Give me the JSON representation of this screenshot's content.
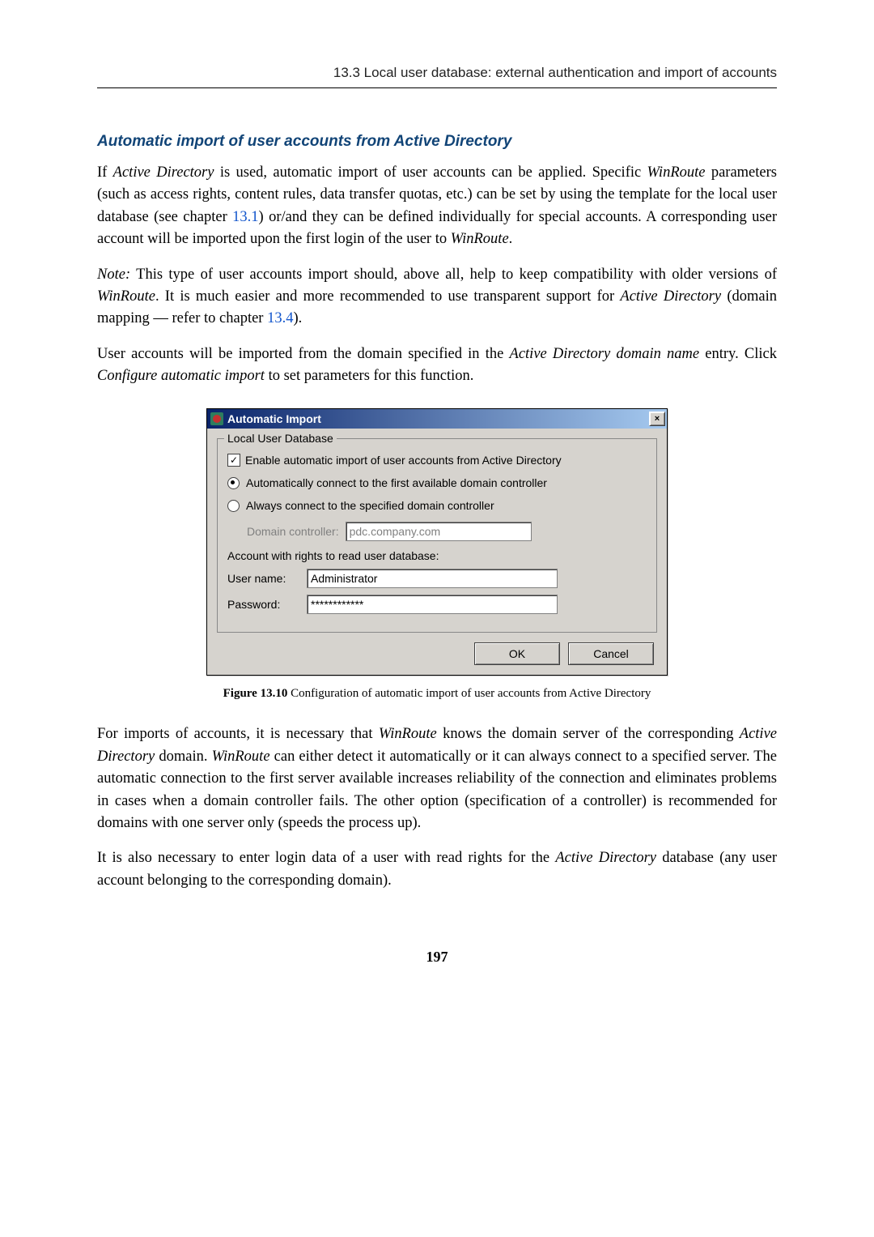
{
  "header": "13.3  Local user database: external authentication and import of accounts",
  "section_heading": "Automatic import of user accounts from Active Directory",
  "para1_a": "If ",
  "para1_b": "Active Directory",
  "para1_c": " is used, automatic import of user accounts can be applied. Specific ",
  "para1_d": "WinRoute",
  "para1_e": " parameters (such as access rights, content rules, data transfer quotas, etc.) can be set by using the template for the local user database (see chapter ",
  "para1_link": "13.1",
  "para1_f": ") or/and they can be defined individually for special accounts. A corresponding user account will be imported upon the first login of the user to ",
  "para1_g": "WinRoute",
  "para1_h": ".",
  "para2_a": "Note:",
  "para2_b": " This type of user accounts import should, above all, help to keep compatibility with older versions of ",
  "para2_c": "WinRoute",
  "para2_d": ". It is much easier and more recommended to use transparent support for ",
  "para2_e": "Active Directory",
  "para2_f": " (domain mapping — refer to chapter ",
  "para2_link": "13.4",
  "para2_g": ").",
  "para3_a": "User accounts will be imported from the domain specified in the ",
  "para3_b": "Active Directory domain name",
  "para3_c": " entry. Click ",
  "para3_d": "Configure automatic import",
  "para3_e": " to set parameters for this function.",
  "dialog": {
    "title": "Automatic Import",
    "close": "×",
    "group_title": "Local User Database",
    "enable_label": "Enable automatic import of user accounts from Active Directory",
    "radio_auto": "Automatically connect to the first available domain controller",
    "radio_spec": "Always connect to the specified domain controller",
    "dc_label": "Domain controller:",
    "dc_value": "pdc.company.com",
    "account_section": "Account with rights to read user database:",
    "user_label": "User name:",
    "user_value": "Administrator",
    "pass_label": "Password:",
    "pass_value": "************",
    "ok": "OK",
    "cancel": "Cancel"
  },
  "caption_bold": "Figure 13.10",
  "caption_rest": "   Configuration of automatic import of user accounts from Active Directory",
  "para4_a": "For imports of accounts, it is necessary that ",
  "para4_b": "WinRoute",
  "para4_c": " knows the domain server of the corresponding ",
  "para4_d": "Active Directory",
  "para4_e": " domain. ",
  "para4_f": "WinRoute",
  "para4_g": " can either detect it automatically or it can always connect to a specified server. The automatic connection to the first server available increases reliability of the connection and eliminates problems in cases when a domain controller fails. The other option (specification of a controller) is recommended for domains with one server only (speeds the process up).",
  "para5_a": "It is also necessary to enter login data of a user with read rights for the ",
  "para5_b": "Active Directory",
  "para5_c": " database (any user account belonging to the corresponding domain).",
  "page_number": "197"
}
